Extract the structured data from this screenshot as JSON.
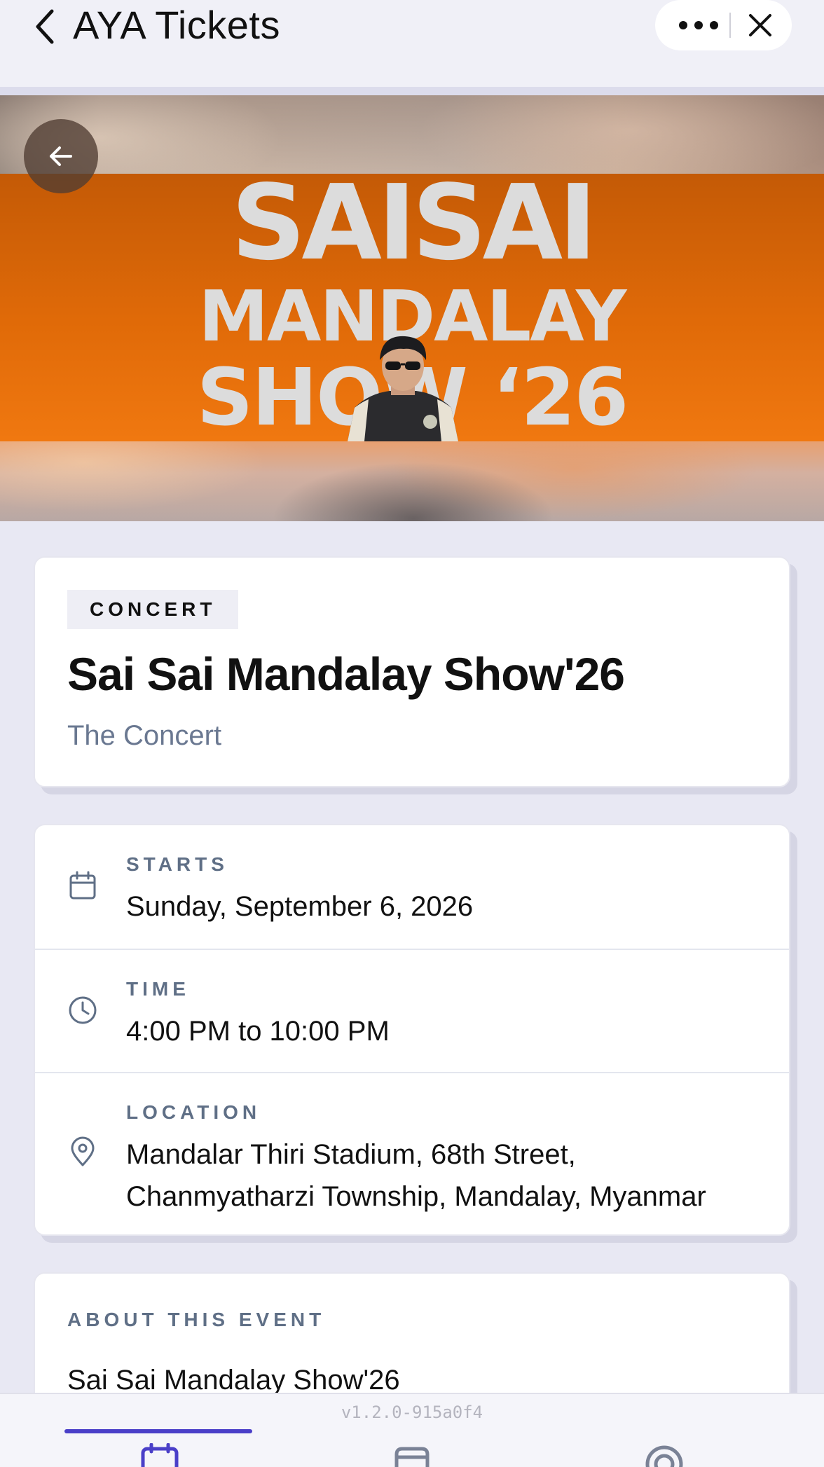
{
  "app": {
    "title": "AYA Tickets",
    "back_icon": "chevron-left-icon",
    "more_icon": "more-horizontal-icon",
    "close_icon": "close-icon"
  },
  "banner": {
    "back_icon": "arrow-left-icon",
    "poster_lines": [
      "SAISAI",
      "MANDALAY",
      "SHOW ‘26"
    ],
    "accent_color": "#e06a08"
  },
  "event": {
    "category": "CONCERT",
    "title": "Sai Sai Mandalay Show'26",
    "subtitle": "The Concert"
  },
  "details": [
    {
      "label": "STARTS",
      "value": "Sunday, September 6, 2026",
      "icon": "calendar-icon"
    },
    {
      "label": "TIME",
      "value": "4:00 PM to 10:00 PM",
      "icon": "clock-icon"
    },
    {
      "label": "LOCATION",
      "value": "Mandalar Thiri Stadium, 68th Street, Chanmyatharzi Township, Mandalay, Myanmar",
      "icon": "map-pin-icon"
    }
  ],
  "about": {
    "heading": "ABOUT THIS EVENT",
    "text": "Sai Sai Mandalay Show'26"
  },
  "footer": {
    "version": "v1.2.0-915a0f4",
    "active_color": "#4a3fc8",
    "nav_icons": [
      "calendar-icon",
      "ticket-icon",
      "target-icon"
    ]
  }
}
